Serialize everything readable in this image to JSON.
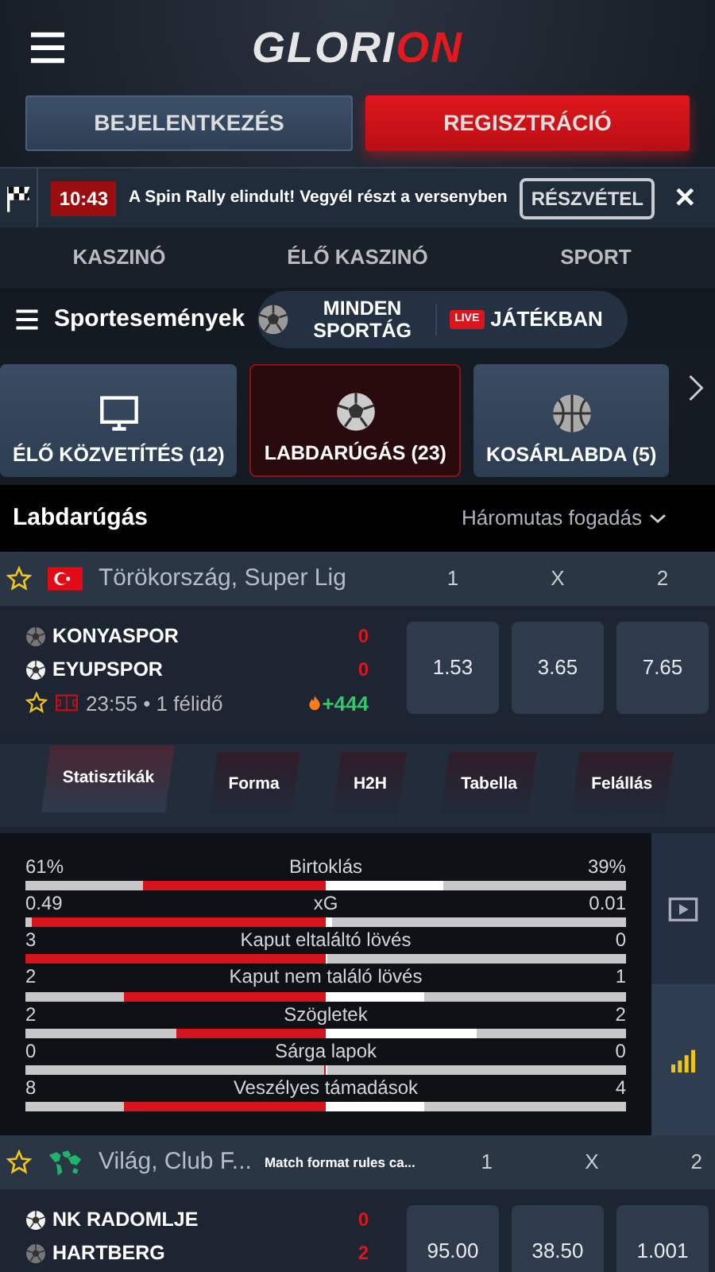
{
  "header": {
    "logo": [
      {
        "text": "GLORI",
        "color": "#e6e6e6"
      },
      {
        "text": "ON",
        "color": "#e3191f"
      }
    ]
  },
  "auth_buttons": [
    {
      "label": "BEJELENTKEZÉS",
      "kind": "secondary"
    },
    {
      "label": "REGISZTRÁCIÓ",
      "kind": "primary"
    }
  ],
  "banner": {
    "time": "10:43",
    "message": "A Spin Rally elindult! Vegyél részt a versenyben",
    "action": "RÉSZVÉTEL",
    "close": "✕"
  },
  "nav_tabs": [
    "KASZINÓ",
    "ÉLŐ KASZINÓ",
    "SPORT"
  ],
  "sport_bar": {
    "menu_label": "Sportesemények",
    "all_sports": "MINDEN SPORTÁG",
    "live_badge": "LIVE",
    "in_play": "JÁTÉKBAN"
  },
  "sport_tiles": [
    {
      "label": "ÉLŐ KÖZVETÍTÉS (12)",
      "kind": "tv",
      "selected": false
    },
    {
      "label": "LABDARÚGÁS (23)",
      "kind": "football",
      "selected": true
    },
    {
      "label": "KOSÁRLABDA (5)",
      "kind": "basketball",
      "selected": false
    }
  ],
  "section": {
    "title": "Labdarúgás",
    "market": "Háromutas fogadás"
  },
  "leagues": [
    {
      "name": "Törökország, Super Lig",
      "kind": "turkey",
      "columns": [
        "1",
        "X",
        "2"
      ],
      "matches": [
        {
          "teams": [
            {
              "name": "KONYASPOR",
              "score": "0",
              "serving": false
            },
            {
              "name": "EYUPSPOR",
              "score": "0",
              "serving": true
            }
          ],
          "time": "23:55 • 1 félidő",
          "more": "+444",
          "odds": [
            "1.53",
            "3.65",
            "7.65"
          ],
          "stats": {
            "tabs": [
              {
                "label": "Statisztikák",
                "selected": true
              },
              {
                "label": "Forma",
                "selected": false
              },
              {
                "label": "H2H",
                "selected": false
              },
              {
                "label": "Tabella",
                "selected": false
              },
              {
                "label": "Felállás",
                "selected": false
              }
            ],
            "rows": [
              {
                "label": "Birtoklás",
                "home": {
                  "value": "61%",
                  "level": 0.61
                },
                "away": {
                  "value": "39%",
                  "level": 0.39
                }
              },
              {
                "label": "xG",
                "home": {
                  "value": "0.49",
                  "level": 0.98
                },
                "away": {
                  "value": "0.01",
                  "level": 0.02
                }
              },
              {
                "label": "Kaput eltaláltó lövés",
                "home": {
                  "value": "3",
                  "level": 1
                },
                "away": {
                  "value": "0",
                  "level": 0
                }
              },
              {
                "label": "Kaput nem találó lövés",
                "home": {
                  "value": "2",
                  "level": 0.67
                },
                "away": {
                  "value": "1",
                  "level": 0.33
                }
              },
              {
                "label": "Szögletek",
                "home": {
                  "value": "2",
                  "level": 0.5
                },
                "away": {
                  "value": "2",
                  "level": 0.5
                }
              },
              {
                "label": "Sárga lapok",
                "home": {
                  "value": "0",
                  "level": 0
                },
                "away": {
                  "value": "0",
                  "level": 0
                }
              },
              {
                "label": "Veszélyes támadások",
                "home": {
                  "value": "8",
                  "level": 0.67
                },
                "away": {
                  "value": "4",
                  "level": 0.33
                }
              }
            ],
            "side_buttons": [
              {
                "kind": "video",
                "selected": false
              },
              {
                "kind": "stats",
                "selected": true
              }
            ]
          }
        }
      ]
    },
    {
      "name": "Világ, Club F...",
      "kind": "world",
      "note": "Match format rules ca...",
      "columns": [
        "1",
        "X",
        "2"
      ],
      "matches": [
        {
          "teams": [
            {
              "name": "NK RADOMLJE",
              "score": "0",
              "serving": true
            },
            {
              "name": "HARTBERG",
              "score": "2",
              "serving": false
            }
          ],
          "odds": [
            "95.00",
            "38.50",
            "1.001"
          ]
        }
      ]
    }
  ]
}
